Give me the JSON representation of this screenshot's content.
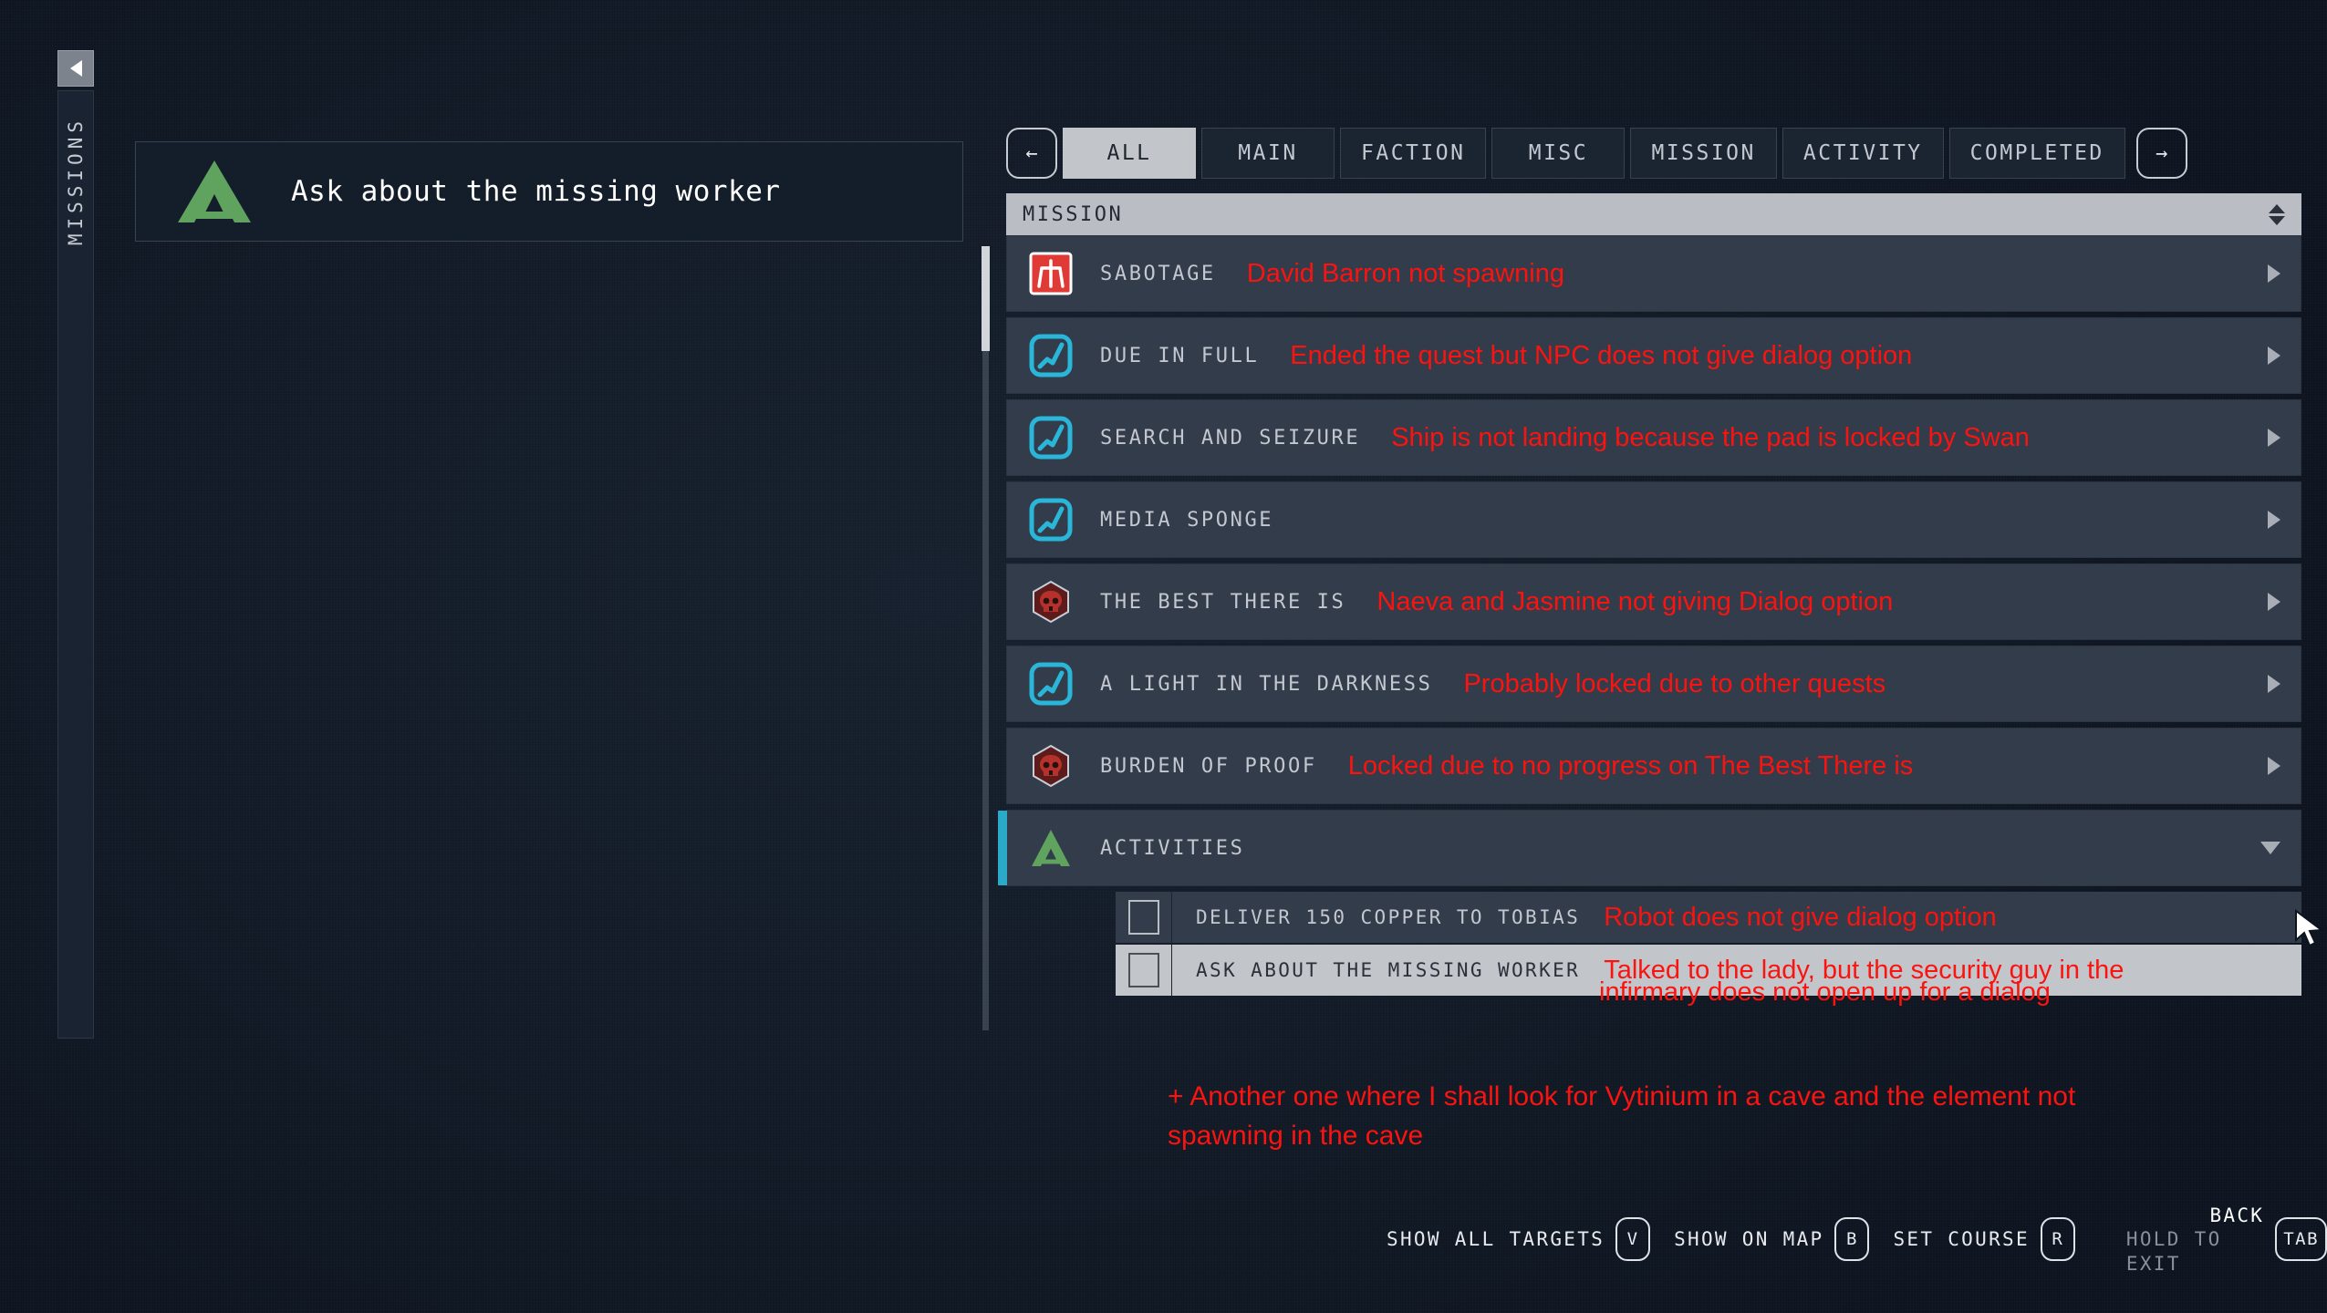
{
  "rail": {
    "collapse_icon": "chevron-left-icon",
    "label": "MISSIONS"
  },
  "detail_card": {
    "logo_icon": "faction-triangle-logo",
    "title": "Ask about the missing worker"
  },
  "tabs": {
    "prev_icon": "arrow-left-icon",
    "next_icon": "arrow-right-icon",
    "items": [
      {
        "label": "ALL",
        "active": true
      },
      {
        "label": "MAIN",
        "active": false
      },
      {
        "label": "FACTION",
        "active": false
      },
      {
        "label": "MISC",
        "active": false
      },
      {
        "label": "MISSION",
        "active": false
      },
      {
        "label": "ACTIVITY",
        "active": false
      },
      {
        "label": "COMPLETED",
        "active": false
      }
    ]
  },
  "column_header": {
    "title": "MISSION",
    "sort_icon": "sort-updown-icon"
  },
  "mission_rows": [
    {
      "icon": "sabotage-red-icon",
      "label": "SABOTAGE",
      "note": "David Barron not spawning",
      "chevron": "chevron-right-icon",
      "accent": false
    },
    {
      "icon": "mission-cyan-icon",
      "label": "DUE IN FULL",
      "note": "Ended the quest but NPC does not give dialog option",
      "chevron": "chevron-right-icon",
      "accent": false
    },
    {
      "icon": "mission-cyan-icon",
      "label": "SEARCH AND SEIZURE",
      "note": "Ship is not landing because the pad is locked by Swan",
      "chevron": "chevron-right-icon",
      "accent": false
    },
    {
      "icon": "mission-cyan-icon",
      "label": "MEDIA SPONGE",
      "note": "",
      "chevron": "chevron-right-icon",
      "accent": false
    },
    {
      "icon": "skull-red-icon",
      "label": "THE BEST THERE IS",
      "note": "Naeva and Jasmine not giving Dialog option",
      "chevron": "chevron-right-icon",
      "accent": false
    },
    {
      "icon": "mission-cyan-icon",
      "label": "A LIGHT IN THE DARKNESS",
      "note": "Probably locked due to other quests",
      "chevron": "chevron-right-icon",
      "accent": false
    },
    {
      "icon": "skull-red-icon",
      "label": "BURDEN OF PROOF",
      "note": "Locked due to no progress on The Best There is",
      "chevron": "chevron-right-icon",
      "accent": false
    },
    {
      "icon": "faction-triangle-logo",
      "label": "ACTIVITIES",
      "note": "",
      "chevron": "chevron-down-icon",
      "accent": true
    }
  ],
  "activity_rows": [
    {
      "checkbox": "unchecked-checkbox",
      "label": "DELIVER 150 COPPER TO TOBIAS",
      "note": "Robot does not give dialog option",
      "selected": false
    },
    {
      "checkbox": "unchecked-checkbox",
      "label": "ASK ABOUT THE MISSING WORKER",
      "note": "Talked to the lady, but the security guy in the",
      "selected": true
    }
  ],
  "annotations": {
    "trailing_line": "infirmary does not open up for a dialog",
    "footer": "+ Another  one where I shall look for Vytinium in a cave and the element not spawning in the cave"
  },
  "hints": [
    {
      "label": "SHOW ALL TARGETS",
      "key": "V"
    },
    {
      "label": "SHOW ON MAP",
      "key": "B"
    },
    {
      "label": "SET COURSE",
      "key": "R"
    }
  ],
  "back_hint": {
    "top": "BACK",
    "sub": "HOLD TO EXIT",
    "key": "TAB"
  },
  "colors": {
    "accent_cyan": "#2aa9c9",
    "annotation_red": "#fb1310",
    "faction_green": "#5fa35f",
    "selected_light": "#c2c6cb",
    "row_bg": "#333c4a"
  }
}
